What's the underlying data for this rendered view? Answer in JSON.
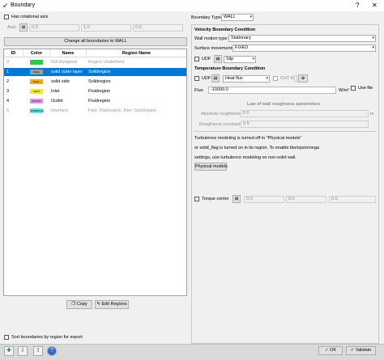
{
  "window": {
    "title": "Boundary",
    "help": "?",
    "close": "✕",
    "check_icon": "check-icon"
  },
  "left": {
    "rotational_axis_label": "Has rotational axis",
    "axis_label": "Axis:",
    "axis_values": [
      "0.0",
      "1.0",
      "0.0"
    ],
    "change_all_button": "Change all boundaries to WALL",
    "table": {
      "headers": [
        "ID",
        "Color",
        "Name",
        "Region Name"
      ],
      "rows": [
        {
          "id": "0",
          "color": "#2ecc40",
          "swatch": "",
          "name": "Not Assigned",
          "region": "Region Undefined",
          "dim": true,
          "selected": false
        },
        {
          "id": "1",
          "color": "#9e9e9e",
          "swatch": "WALL",
          "name": "solid outer layer",
          "region": "Solidregion",
          "dim": false,
          "selected": true
        },
        {
          "id": "2",
          "color": "#f5a623",
          "swatch": "WALL",
          "name": "solid side",
          "region": "Solidregion",
          "dim": false,
          "selected": false
        },
        {
          "id": "3",
          "color": "#f8e71c",
          "swatch": "INLET",
          "name": "Inlet",
          "region": "Fluidregion",
          "dim": false,
          "selected": false
        },
        {
          "id": "4",
          "color": "#e58ef5",
          "swatch": "OUTLET",
          "name": "Outlet",
          "region": "Fluidregion",
          "dim": false,
          "selected": false
        },
        {
          "id": "5",
          "color": "#5ae6f0",
          "swatch": "INTERFACE",
          "name": "interface",
          "region": "Fwd: Fluidregion, Rev: Solidregion",
          "dim": true,
          "selected": false
        }
      ]
    },
    "copy_button": "Copy",
    "edit_regions_button": "Edit Regions",
    "sort_label": "Sort boundaries by region for export"
  },
  "right": {
    "boundary_type_label": "Boundary Type:",
    "boundary_type_value": "WALL",
    "velocity": {
      "title": "Velocity Boundary Condition",
      "wall_motion_label": "Wall motion type:",
      "wall_motion_value": "Stationary",
      "surface_movement_label": "Surface movement:",
      "surface_movement_value": "FIXED",
      "udf_label": "UDF",
      "slip_value": "Slip"
    },
    "temperature": {
      "title": "Temperature Boundary Condition",
      "udf_label": "UDF",
      "heat_flux_value": "Heat flux",
      "cht_label": "CHT ID",
      "flux_label": "Flux:",
      "flux_value": "-10000.0",
      "flux_unit": "W/m²",
      "use_file_label": "Use file"
    },
    "roughness": {
      "title": "Law of wall roughness parameters",
      "abs_label": "Absolute roughness:",
      "abs_value": "0.0",
      "abs_unit": "m",
      "const_label": "Roughness constant:",
      "const_value": "0.5"
    },
    "turbulence_lines": [
      "Turbulence modeling is turned off in \"Physical models\"",
      "or solid_flag is turned on in its region. To enable tke/eps/omega",
      "settings, use turbulence modeling on non-solid wall."
    ],
    "physical_models_button": "Physical models",
    "torque_label": "Torque center",
    "torque_values": [
      "0.0",
      "0.0",
      "0.0"
    ]
  },
  "footer": {
    "ok": "OK",
    "validate": "Validate",
    "ok_icon": "check-icon",
    "validate_icon": "check-icon"
  }
}
